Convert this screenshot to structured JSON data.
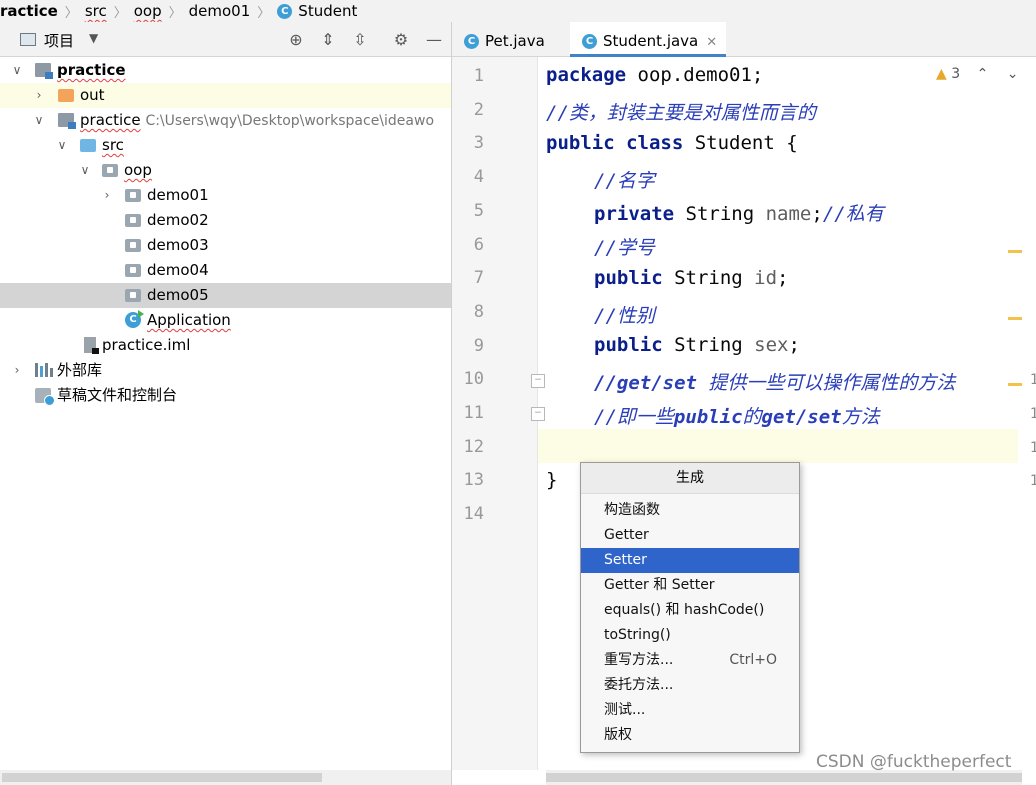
{
  "breadcrumb": {
    "items": [
      "ractice",
      "src",
      "oop",
      "demo01",
      "Student"
    ]
  },
  "project_panel": {
    "title": "项目",
    "tree": [
      {
        "label": "practice"
      },
      {
        "label": "out"
      },
      {
        "label": "practice",
        "hint": "C:\\Users\\wqy\\Desktop\\workspace\\ideawo"
      },
      {
        "label": "src"
      },
      {
        "label": "oop"
      },
      {
        "label": "demo01"
      },
      {
        "label": "demo02"
      },
      {
        "label": "demo03"
      },
      {
        "label": "demo04"
      },
      {
        "label": "demo05"
      },
      {
        "label": "Application"
      },
      {
        "label": "practice.iml"
      },
      {
        "label": "外部库"
      },
      {
        "label": "草稿文件和控制台"
      }
    ]
  },
  "editor": {
    "tabs": [
      {
        "label": "Pet.java",
        "icon": "C"
      },
      {
        "label": "Student.java",
        "icon": "C"
      }
    ],
    "warnings": "3",
    "line_numbers": [
      "1",
      "2",
      "3",
      "4",
      "5",
      "6",
      "7",
      "8",
      "9",
      "10",
      "11",
      "12",
      "13",
      "14"
    ],
    "code": {
      "l1_kw": "package",
      "l1_rest": " oop.demo01;",
      "l2_cm": "//类，封装主要是对属性而言的",
      "l3_kw": "public class",
      "l3_rest": " Student {",
      "l4_cm": "//名字",
      "l5_kw": "private",
      "l5_type": " String ",
      "l5_field": "name",
      "l5_semi": ";",
      "l5_cm": "//私有",
      "l6_cm": "//学号",
      "l7_kw": "public",
      "l7_type": " String ",
      "l7_field": "id",
      "l7_semi": ";",
      "l8_cm": "//性别",
      "l9_kw": "public",
      "l9_type": " String ",
      "l9_field": "sex",
      "l9_semi": ";",
      "l10_a": "//get/set",
      "l10_b": " 提供一些可以操作属性的方法",
      "l11_a": "//即一些",
      "l11_b": "public",
      "l11_c": "的",
      "l11_d": "get/set",
      "l11_e": "方法",
      "l13": "}"
    },
    "minimap_digits": [
      "1",
      "1",
      "1",
      "1"
    ]
  },
  "generate_popup": {
    "title": "生成",
    "items": [
      {
        "label": "构造函数"
      },
      {
        "label": "Getter"
      },
      {
        "label": "Setter"
      },
      {
        "label": "Getter 和 Setter"
      },
      {
        "label": "equals() 和 hashCode()"
      },
      {
        "label": "toString()"
      },
      {
        "label": "重写方法...",
        "shortcut": "Ctrl+O"
      },
      {
        "label": "委托方法..."
      },
      {
        "label": "测试..."
      },
      {
        "label": "版权"
      }
    ]
  },
  "watermark": "CSDN @fucktheperfect",
  "colors": {
    "accent": "#2f65ca",
    "keyword": "#0a1f8a",
    "comment": "#2a3eb8",
    "caret_line": "#fdfce5"
  }
}
